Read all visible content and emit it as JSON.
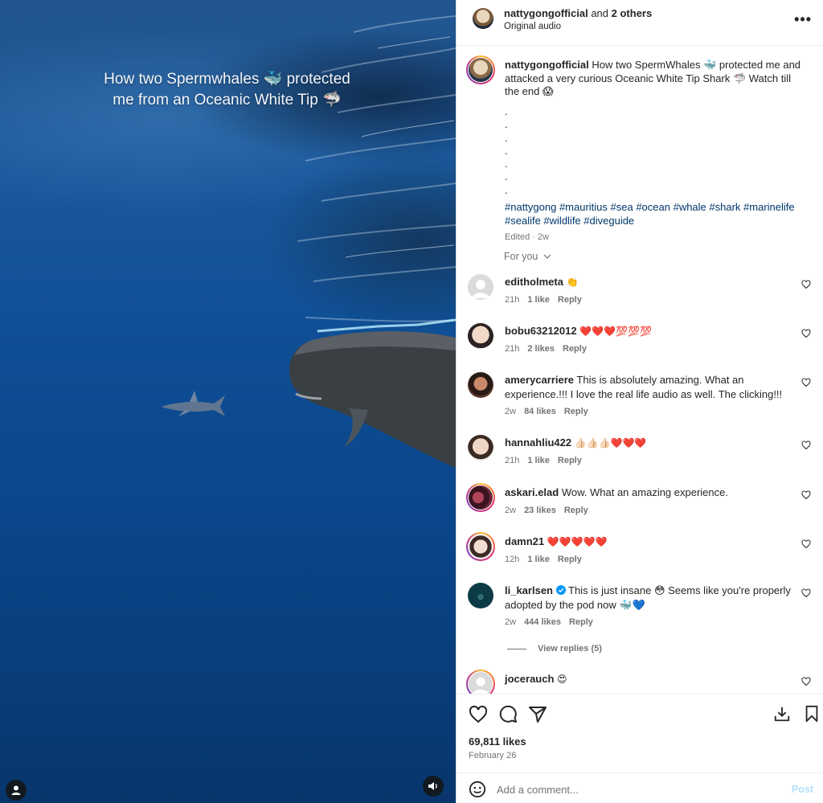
{
  "video": {
    "overlay_line1": "How two Spermwhales 🐳 protected",
    "overlay_line2": "me from an Oceanic White Tip 🦈",
    "user_tag_icon": "person-icon",
    "mute_icon": "speaker-icon"
  },
  "header": {
    "author": "nattygongofficial",
    "and_text": " and ",
    "others": "2 others",
    "audio": "Original audio",
    "more_label": "•••"
  },
  "caption": {
    "author": "nattygongofficial",
    "text": "How two SpermWhales 🐳 protected me and attacked a very curious Oceanic White Tip Shark 🦈 Watch till the end 😱",
    "dots": ".\n.\n.\n.\n.\n.\n.",
    "hashtags": "#nattygong #mauritius #sea #ocean #whale #shark #marinelife #sealife #wildlife #diveguide",
    "edited": "Edited · 2w"
  },
  "for_you": "For you",
  "comments": [
    {
      "user": "editholmeta",
      "text": "👏",
      "time": "21h",
      "likes": "1 like",
      "reply": "Reply"
    },
    {
      "user": "bobu63212012",
      "text": "❤️❤️❤️💯💯💯",
      "time": "21h",
      "likes": "2 likes",
      "reply": "Reply"
    },
    {
      "user": "amerycarriere",
      "text": "This is absolutely amazing. What an experience.!!! I love the real life audio as well. The clicking!!!",
      "time": "2w",
      "likes": "84 likes",
      "reply": "Reply"
    },
    {
      "user": "hannahliu422",
      "text": "👍🏻👍🏻👍🏻❤️❤️❤️",
      "time": "21h",
      "likes": "1 like",
      "reply": "Reply"
    },
    {
      "user": "askari.elad",
      "text": "Wow. What an amazing experience.",
      "time": "2w",
      "likes": "23 likes",
      "reply": "Reply"
    },
    {
      "user": "damn21",
      "text": "❤️❤️❤️❤️❤️",
      "time": "12h",
      "likes": "1 like",
      "reply": "Reply"
    },
    {
      "user": "li_karlsen",
      "text": "This is just insane 😳 Seems like you're properly adopted by the pod now 🐳💙",
      "time": "2w",
      "likes": "444 likes",
      "reply": "Reply",
      "verified": true
    },
    {
      "user": "jocerauch",
      "text": "😍",
      "time": "",
      "likes": "",
      "reply": ""
    }
  ],
  "view_replies": "View replies (5)",
  "actions": {
    "like_icon": "heart-icon",
    "comment_icon": "comment-icon",
    "share_icon": "send-icon",
    "download_icon": "download-icon",
    "save_icon": "bookmark-icon",
    "likes_count": "69,811 likes",
    "date": "February 26"
  },
  "add_comment": {
    "placeholder": "Add a comment...",
    "post_label": "Post",
    "emoji_icon": "smiley-icon"
  },
  "colors": {
    "link": "#00376b",
    "muted": "#737373",
    "post_disabled": "#b2dffc",
    "verified": "#0095f6"
  }
}
